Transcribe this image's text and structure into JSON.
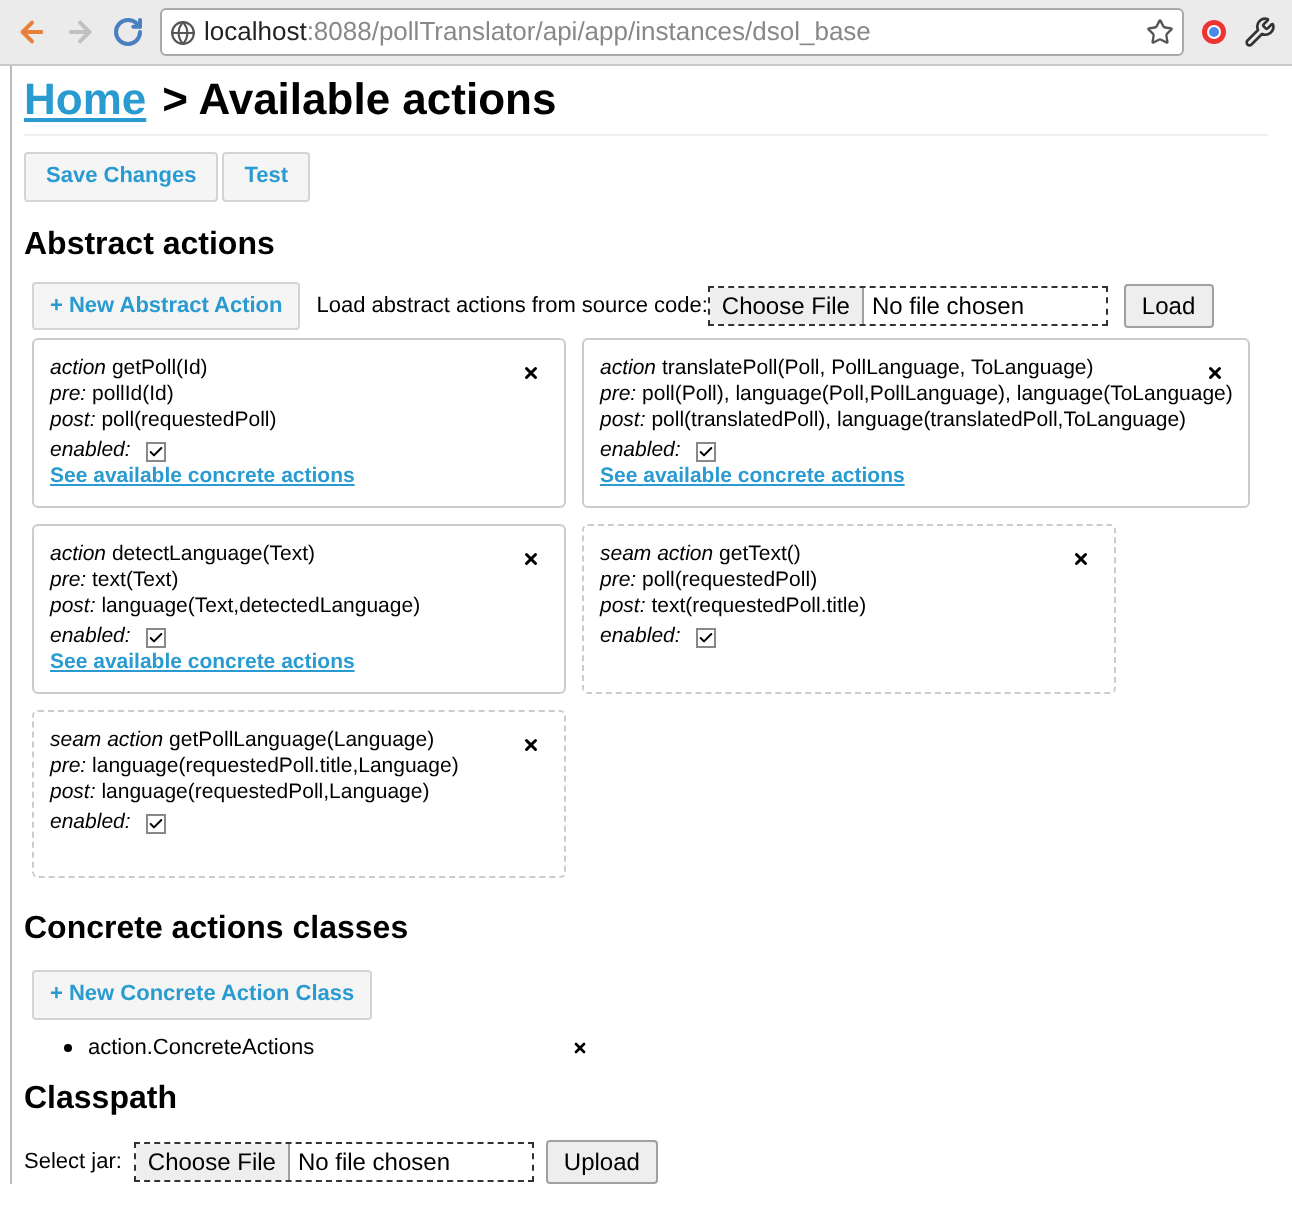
{
  "browser": {
    "url_host": "localhost",
    "url_path": ":8088/pollTranslator/api/app/instances/dsol_base"
  },
  "header": {
    "home_link": "Home",
    "title": "> Available actions"
  },
  "toolbar": [
    "Save Changes",
    "Test"
  ],
  "abstract": {
    "heading": "Abstract actions",
    "new_button": "+ New Abstract Action",
    "load_label": "Load abstract actions from source code:",
    "file_button": "Choose File",
    "file_status": "No file chosen",
    "load_button": "Load",
    "cards": [
      {
        "kind": "action",
        "prefix": "action",
        "signature": "getPoll(Id)",
        "pre_label": "pre:",
        "pre": "pollId(Id)",
        "post_label": "post:",
        "post": "poll(requestedPoll)",
        "enabled_label": "enabled:",
        "enabled": true,
        "link": "See available concrete actions"
      },
      {
        "kind": "action",
        "prefix": "action",
        "signature": "translatePoll(Poll, PollLanguage, ToLanguage)",
        "pre_label": "pre:",
        "pre": "poll(Poll), language(Poll,PollLanguage), language(ToLanguage)",
        "post_label": "post:",
        "post": "poll(translatedPoll), language(translatedPoll,ToLanguage)",
        "enabled_label": "enabled:",
        "enabled": true,
        "link": "See available concrete actions"
      },
      {
        "kind": "action",
        "prefix": "action",
        "signature": "detectLanguage(Text)",
        "pre_label": "pre:",
        "pre": "text(Text)",
        "post_label": "post:",
        "post": "language(Text,detectedLanguage)",
        "enabled_label": "enabled:",
        "enabled": true,
        "link": "See available concrete actions"
      },
      {
        "kind": "seam",
        "prefix": "seam action",
        "signature": "getText()",
        "pre_label": "pre:",
        "pre": "poll(requestedPoll)",
        "post_label": "post:",
        "post": "text(requestedPoll.title)",
        "enabled_label": "enabled:",
        "enabled": true
      },
      {
        "kind": "seam",
        "prefix": "seam action",
        "signature": "getPollLanguage(Language)",
        "pre_label": "pre:",
        "pre": "language(requestedPoll.title,Language)",
        "post_label": "post:",
        "post": "language(requestedPoll,Language)",
        "enabled_label": "enabled:",
        "enabled": true
      }
    ]
  },
  "concrete": {
    "heading": "Concrete actions classes",
    "new_button": "+ New Concrete Action Class",
    "items": [
      "action.ConcreteActions"
    ]
  },
  "classpath": {
    "heading": "Classpath",
    "label": "Select jar:",
    "file_button": "Choose File",
    "file_status": "No file chosen",
    "upload_button": "Upload"
  }
}
